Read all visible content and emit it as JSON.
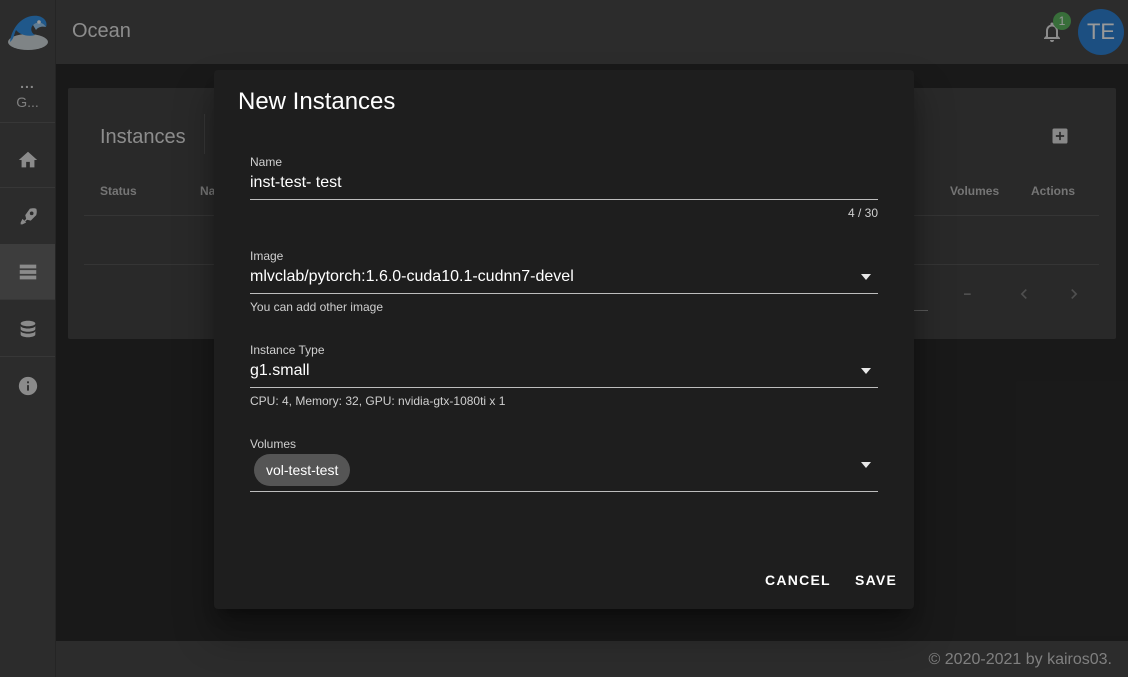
{
  "app": {
    "title": "Ocean"
  },
  "sidebar": {
    "workspace_dots": "...",
    "workspace_label": "G...",
    "items": [
      {
        "icon": "home-icon",
        "active": false
      },
      {
        "icon": "rocket-icon",
        "active": false
      },
      {
        "icon": "server-icon",
        "active": true
      },
      {
        "icon": "database-icon",
        "active": false
      },
      {
        "icon": "info-icon",
        "active": false
      }
    ]
  },
  "header": {
    "notification_count": "1",
    "avatar_initials": "TE"
  },
  "page": {
    "card_title": "Instances",
    "columns": [
      "Status",
      "Na",
      "Volumes",
      "Actions"
    ],
    "pagination_range": "–"
  },
  "footer": {
    "text": "© 2020-2021 by kairos03."
  },
  "dialog": {
    "title": "New Instances",
    "name": {
      "label": "Name",
      "value": "inst-test- test",
      "counter": "4 / 30"
    },
    "image": {
      "label": "Image",
      "value": "mlvclab/pytorch:1.6.0-cuda10.1-cudnn7-devel",
      "hint": "You can add other image"
    },
    "instance_type": {
      "label": "Instance Type",
      "value": "g1.small",
      "hint": "CPU: 4, Memory: 32, GPU: nvidia-gtx-1080ti x 1"
    },
    "volumes": {
      "label": "Volumes",
      "chips": [
        "vol-test-test"
      ]
    },
    "cancel_label": "CANCEL",
    "save_label": "SAVE"
  },
  "colors": {
    "avatar": "#1976d2",
    "badge": "#4caf50",
    "dialog_bg": "#1e1e1e",
    "chip_bg": "#555555"
  }
}
